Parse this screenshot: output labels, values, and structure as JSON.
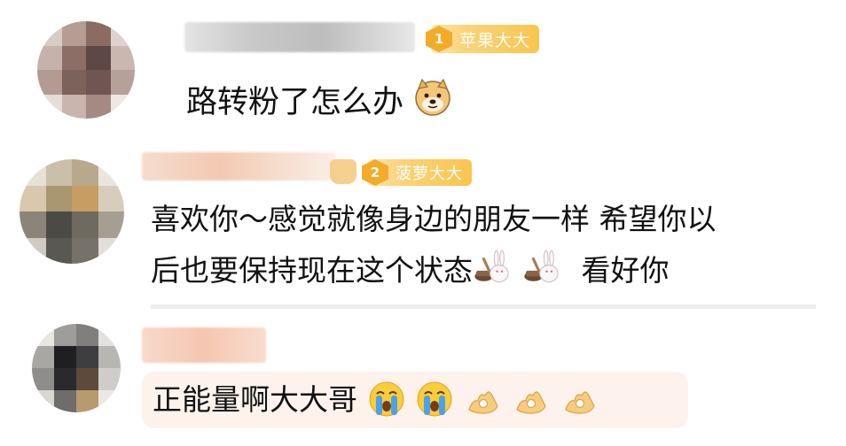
{
  "comments": [
    {
      "badge": {
        "rank": "1",
        "label": "苹果大大"
      },
      "text_before": "路转粉了怎么办",
      "emojis": [
        "doge-emoji"
      ]
    },
    {
      "badge": {
        "rank": "2",
        "label": "菠萝大大"
      },
      "line1": "喜欢你～感觉就像身边的朋友一样 希望你以",
      "line2_before": "后也要保持现在这个状态",
      "line2_after": " 看好你",
      "emojis": [
        "rabbit-mortar-emoji",
        "rabbit-mortar-emoji"
      ]
    },
    {
      "text_before": "正能量啊大大哥",
      "emojis": [
        "crying-face-emoji",
        "crying-face-emoji",
        "ok-hand-emoji",
        "ok-hand-emoji",
        "ok-hand-emoji"
      ]
    }
  ],
  "colors": {
    "badge": "#f9c54d",
    "badge_number": "#f4ab2a",
    "bubble": "#fef3ec",
    "divider": "#eeeeee"
  }
}
